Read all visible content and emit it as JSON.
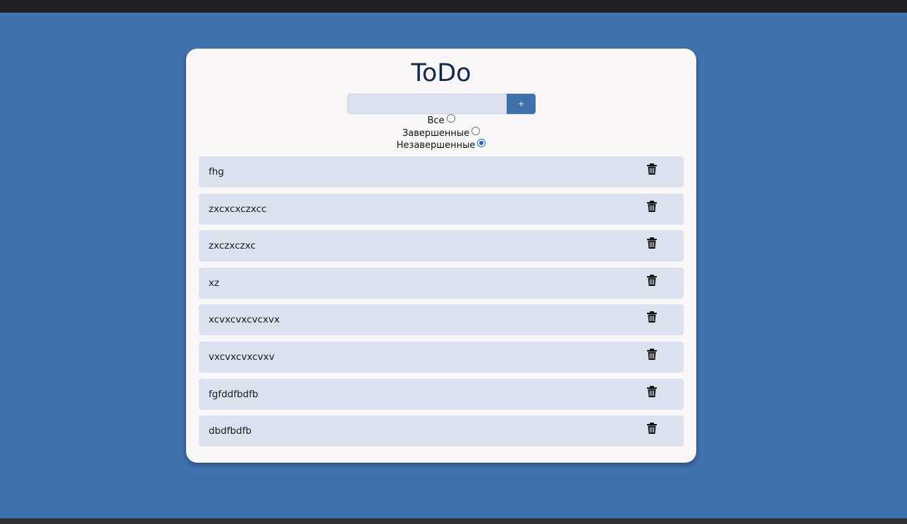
{
  "app": {
    "title": "ToDo"
  },
  "add_form": {
    "input_value": "",
    "input_placeholder": "",
    "add_button_label": "+"
  },
  "filters": [
    {
      "label": "Все",
      "checked": false
    },
    {
      "label": "Завершенные",
      "checked": false
    },
    {
      "label": "Незавершенные",
      "checked": true
    }
  ],
  "todos": [
    {
      "text": "fhg",
      "icon": "trash-icon"
    },
    {
      "text": "zxcxcxczxcc",
      "icon": "trash-icon"
    },
    {
      "text": "zxczxczxc",
      "icon": "trash-icon"
    },
    {
      "text": "xz",
      "icon": "trash-icon"
    },
    {
      "text": "xcvxcvxcvcxvx",
      "icon": "trash-icon"
    },
    {
      "text": "vxcvxcvxcvxv",
      "icon": "trash-icon"
    },
    {
      "text": "fgfddfbdfb",
      "icon": "trash-icon"
    },
    {
      "text": "dbdfbdfb",
      "icon": "trash-icon"
    }
  ],
  "colors": {
    "page_background": "#4072b0",
    "card_background": "#f8f6f7",
    "item_background": "#dbe2ee",
    "title_color": "#102a4a",
    "accent": "#4072b0",
    "radio_checked": "#1a66c9"
  }
}
